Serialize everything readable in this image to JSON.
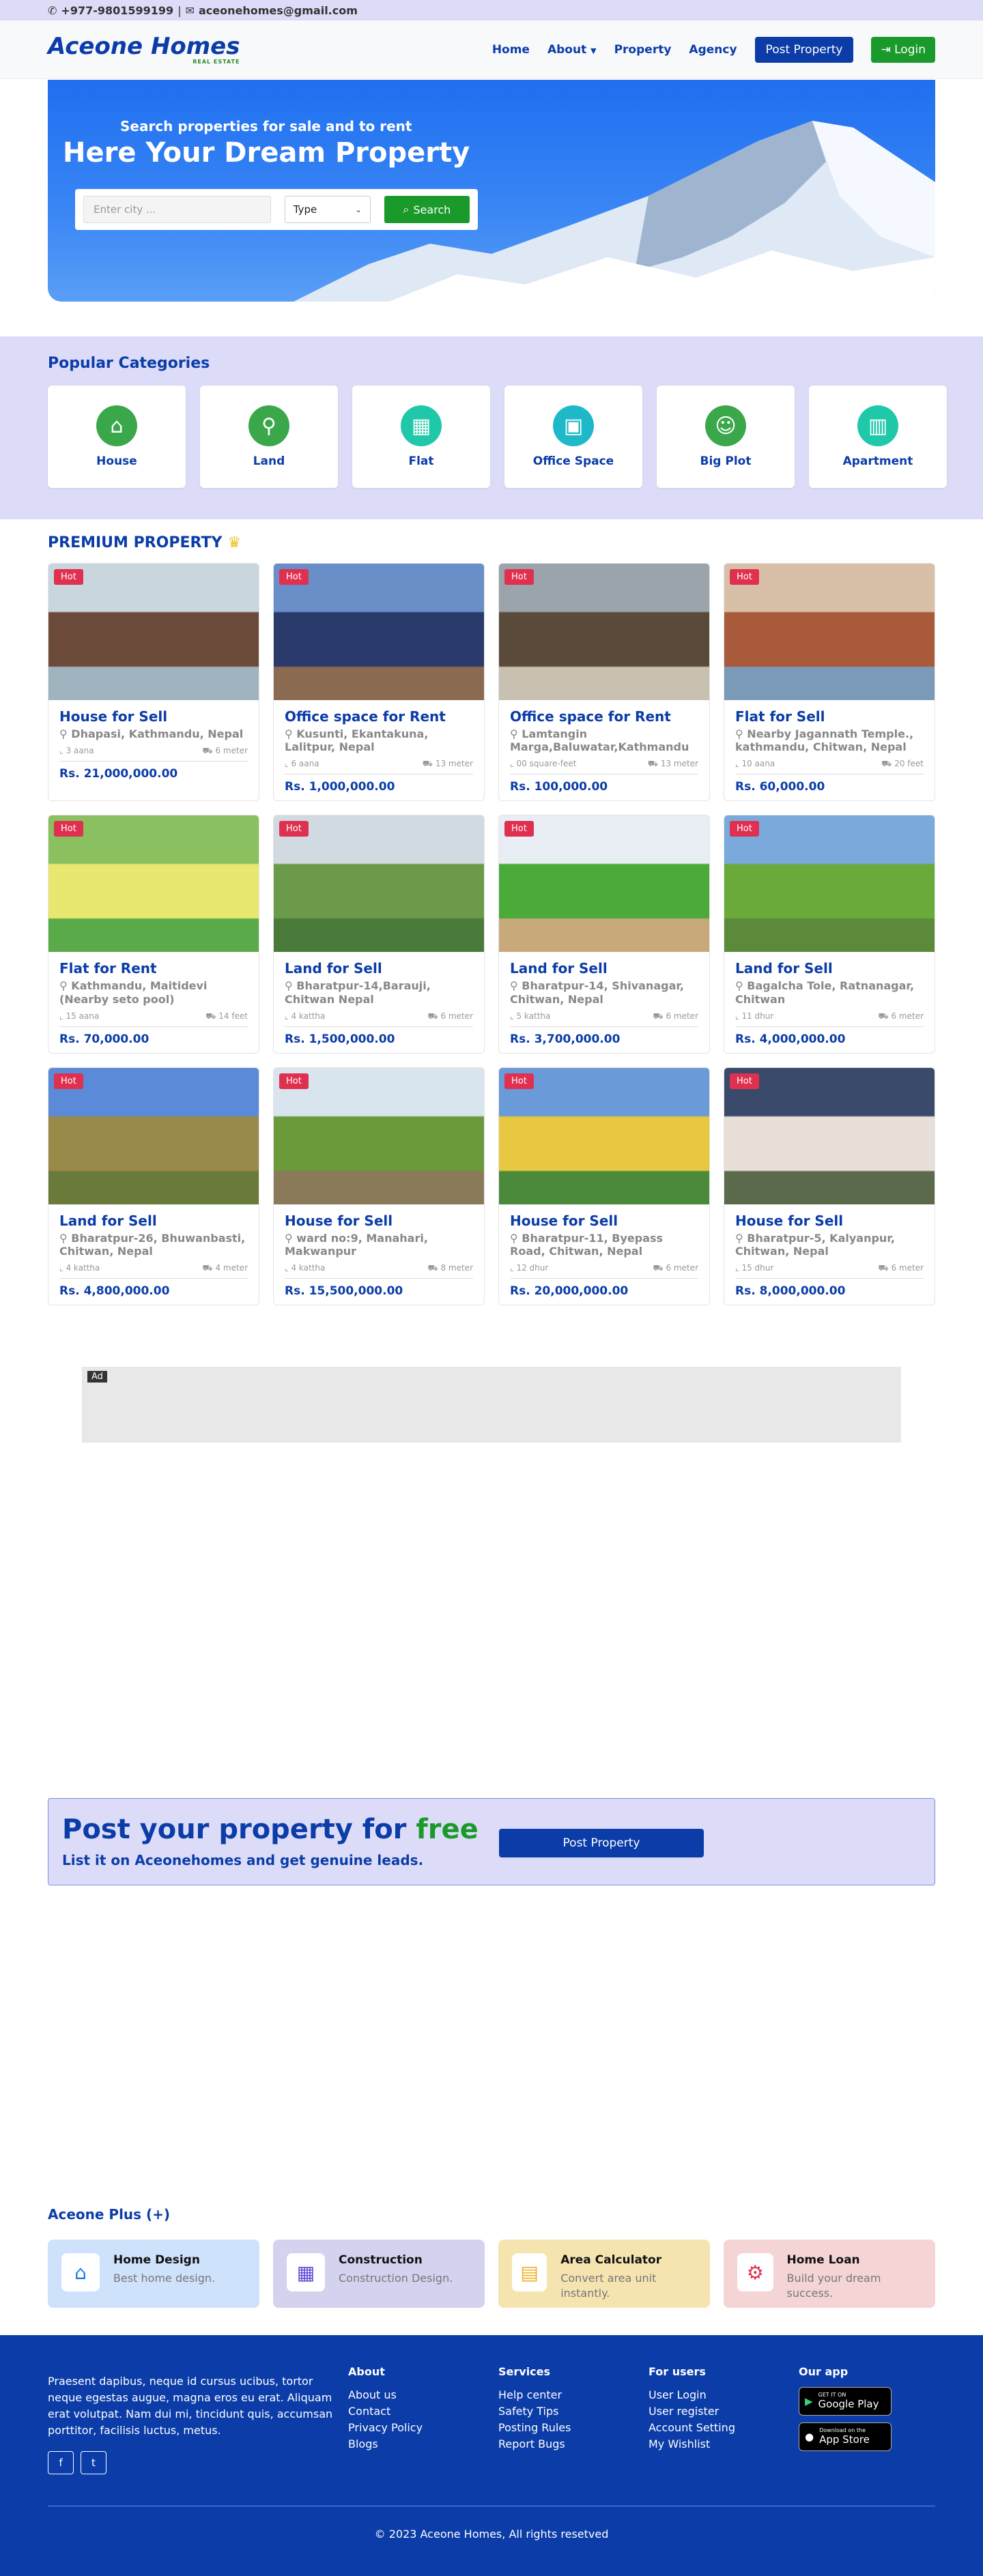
{
  "topbar": {
    "phone": "+977-9801599199",
    "separator": "|",
    "email": "aceonehomes@gmail.com"
  },
  "nav": {
    "logo": "Aceone Homes",
    "tagline": "REAL ESTATE",
    "links": [
      "Home",
      "About",
      "Property",
      "Agency"
    ],
    "post_label": "Post Property",
    "login_label": "Login"
  },
  "hero": {
    "subtitle": "Search properties for sale and to rent",
    "title": "Here Your Dream Property",
    "city_placeholder": "Enter city ...",
    "type_label": "Type",
    "search_label": "Search"
  },
  "categories": {
    "title": "Popular Categories",
    "items": [
      {
        "label": "House",
        "icon": "house-icon",
        "color": "#3aa84a"
      },
      {
        "label": "Land",
        "icon": "map-pin-icon",
        "color": "#3aa84a"
      },
      {
        "label": "Flat",
        "icon": "building-icon",
        "color": "#1fc8a8"
      },
      {
        "label": "Office Space",
        "icon": "briefcase-icon",
        "color": "#1fb8c8"
      },
      {
        "label": "Big Plot",
        "icon": "people-icon",
        "color": "#3aa84a"
      },
      {
        "label": "Apartment",
        "icon": "apartment-icon",
        "color": "#1fc8a8"
      }
    ]
  },
  "premium": {
    "title": "PREMIUM PROPERTY"
  },
  "properties": [
    {
      "badge": "Hot",
      "title": "House for Sell",
      "location": "Dhapasi, Kathmandu, Nepal",
      "area": "3 aana",
      "road": "6 meter",
      "price": "Rs. 21,000,000.00",
      "palette": [
        "#c9d6de",
        "#6b4a3a",
        "#a0b4c0"
      ]
    },
    {
      "badge": "Hot",
      "title": "Office space for Rent",
      "location": "Kusunti, Ekantakuna, Lalitpur, Nepal",
      "area": "6 aana",
      "road": "13 meter",
      "price": "Rs. 1,000,000.00",
      "palette": [
        "#6a8fc8",
        "#2a3a6a",
        "#8a6a50"
      ]
    },
    {
      "badge": "Hot",
      "title": "Office space for Rent",
      "location": "Lamtangin Marga,Baluwatar,Kathmandu",
      "area": "00 square-feet",
      "road": "13 meter",
      "price": "Rs. 100,000.00",
      "palette": [
        "#9aa4aa",
        "#5a4a3a",
        "#c8c0b0"
      ]
    },
    {
      "badge": "Hot",
      "title": "Flat for Sell",
      "location": "Nearby Jagannath Temple., kathmandu, Chitwan, Nepal",
      "area": "10 aana",
      "road": "20 feet",
      "price": "Rs. 60,000.00",
      "palette": [
        "#d8c0a8",
        "#a85a3a",
        "#7a9ab8"
      ]
    },
    {
      "badge": "Hot",
      "title": "Flat for Rent",
      "location": "Kathmandu, Maitidevi (Nearby seto pool)",
      "area": "15 aana",
      "road": "14 feet",
      "price": "Rs. 70,000.00",
      "palette": [
        "#8ac060",
        "#e8e870",
        "#5aaa4a"
      ]
    },
    {
      "badge": "Hot",
      "title": "Land for Sell",
      "location": "Bharatpur-14,Barauji, Chitwan Nepal",
      "area": "4 kattha",
      "road": "6 meter",
      "price": "Rs. 1,500,000.00",
      "palette": [
        "#d0dae0",
        "#6a9a4a",
        "#4a7a3a"
      ]
    },
    {
      "badge": "Hot",
      "title": "Land for Sell",
      "location": "Bharatpur-14, Shivanagar, Chitwan, Nepal",
      "area": "5 kattha",
      "road": "6 meter",
      "price": "Rs. 3,700,000.00",
      "palette": [
        "#e8eef4",
        "#4aaa3a",
        "#c8aa7a"
      ]
    },
    {
      "badge": "Hot",
      "title": "Land for Sell",
      "location": "Bagalcha Tole, Ratnanagar, Chitwan",
      "area": "11 dhur",
      "road": "6 meter",
      "price": "Rs. 4,000,000.00",
      "palette": [
        "#7aaadc",
        "#6aaa3a",
        "#5a8a3a"
      ]
    },
    {
      "badge": "Hot",
      "title": "Land for Sell",
      "location": "Bharatpur-26, Bhuwanbasti, Chitwan, Nepal",
      "area": "4 kattha",
      "road": "4 meter",
      "price": "Rs. 4,800,000.00",
      "palette": [
        "#5a8ad8",
        "#9a8a4a",
        "#6a7a3a"
      ]
    },
    {
      "badge": "Hot",
      "title": "House for Sell",
      "location": "ward no:9, Manahari, Makwanpur",
      "area": "4 kattha",
      "road": "8 meter",
      "price": "Rs. 15,500,000.00",
      "palette": [
        "#d8e4ee",
        "#6a9a3a",
        "#8a7a5a"
      ]
    },
    {
      "badge": "Hot",
      "title": "House for Sell",
      "location": "Bharatpur-11, Byepass Road, Chitwan, Nepal",
      "area": "12 dhur",
      "road": "6 meter",
      "price": "Rs. 20,000,000.00",
      "palette": [
        "#6a9ad8",
        "#e8c840",
        "#4a8a3a"
      ]
    },
    {
      "badge": "Hot",
      "title": "House for Sell",
      "location": "Bharatpur-5, Kalyanpur, Chitwan, Nepal",
      "area": "15 dhur",
      "road": "6 meter",
      "price": "Rs. 8,000,000.00",
      "palette": [
        "#3a4a6a",
        "#e8e0d8",
        "#5a6a4a"
      ]
    }
  ],
  "ad": {
    "label": "Ad"
  },
  "post_cta": {
    "heading": "Post your property for",
    "heading_accent": "free",
    "subheading": "List it on Aceonehomes and get genuine leads.",
    "button": "Post Property"
  },
  "plus": {
    "title": "Aceone Plus (+)",
    "items": [
      {
        "title": "Home Design",
        "desc": "Best home design.",
        "icon": "house-icon",
        "bg": "#cfe2fb",
        "color": "#1f7ae8"
      },
      {
        "title": "Construction",
        "desc": "Construction Design.",
        "icon": "building-icon",
        "bg": "#d3d3f0",
        "color": "#5a4ad8"
      },
      {
        "title": "Area Calculator",
        "desc": "Convert area unit instantly.",
        "icon": "calculator-icon",
        "bg": "#f6e4b0",
        "color": "#f0b020"
      },
      {
        "title": "Home Loan",
        "desc": "Build your dream success.",
        "icon": "gears-icon",
        "bg": "#f5d4d6",
        "color": "#e03050"
      }
    ]
  },
  "footer": {
    "about": "Praesent dapibus, neque id cursus ucibus, tortor neque egestas augue, magna eros eu erat. Aliquam erat volutpat. Nam dui mi, tincidunt quis, accumsan porttitor, facilisis luctus, metus.",
    "social": [
      "f",
      "t"
    ],
    "columns": [
      {
        "title": "About",
        "links": [
          "About us",
          "Contact",
          "Privacy Policy",
          "Blogs"
        ]
      },
      {
        "title": "Services",
        "links": [
          "Help center",
          "Safety Tips",
          "Posting Rules",
          "Report Bugs"
        ]
      },
      {
        "title": "For users",
        "links": [
          "User Login",
          "User register",
          "Account Setting",
          "My Wishlist"
        ]
      }
    ],
    "app_title": "Our app",
    "apps": [
      {
        "small": "GET IT ON",
        "name": "Google Play"
      },
      {
        "small": "Download on the",
        "name": "App Store"
      }
    ],
    "copyright": "© 2023 Aceone Homes, All rights resetved"
  }
}
